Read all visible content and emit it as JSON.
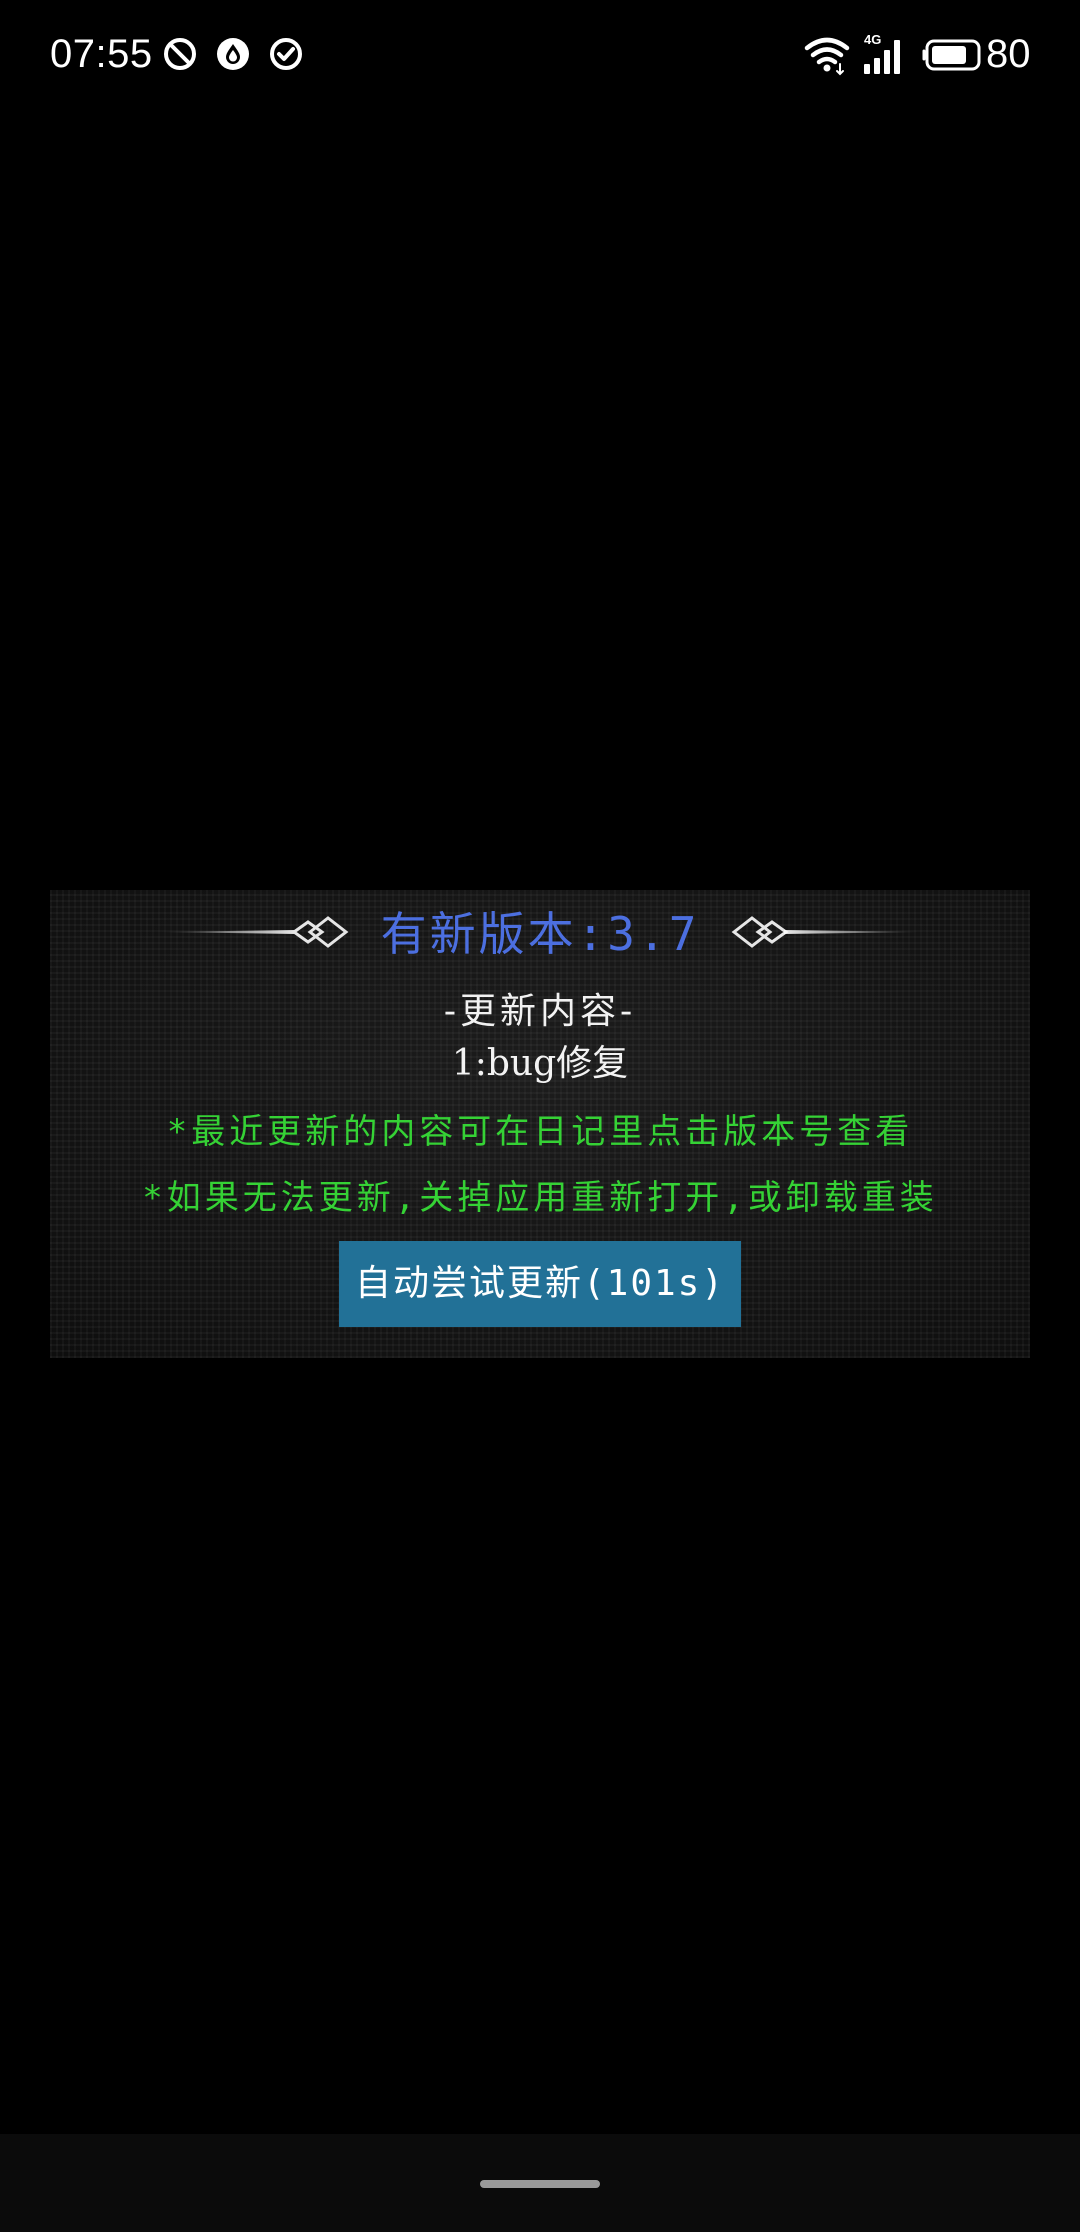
{
  "status_bar": {
    "time": "07:55",
    "left_icons": [
      "do-not-disturb-icon",
      "water-drop-icon",
      "check-circle-icon"
    ],
    "right_icons": [
      "wifi-icon",
      "signal-4g-icon",
      "battery-icon"
    ],
    "network_label": "4G",
    "battery_percent": "80"
  },
  "dialog": {
    "title": "有新版本:3.7",
    "section_heading": "-更新内容-",
    "change_items": [
      "1:bug修复"
    ],
    "notes": [
      "*最近更新的内容可在日记里点击版本号查看",
      "*如果无法更新,关掉应用重新打开,或卸载重装"
    ],
    "button_label": "自动尝试更新(101s)",
    "colors": {
      "title": "#4c6fe0",
      "notes": "#35d235",
      "button": "#227197"
    }
  },
  "nav_bar": {
    "indicator": "home-indicator"
  }
}
